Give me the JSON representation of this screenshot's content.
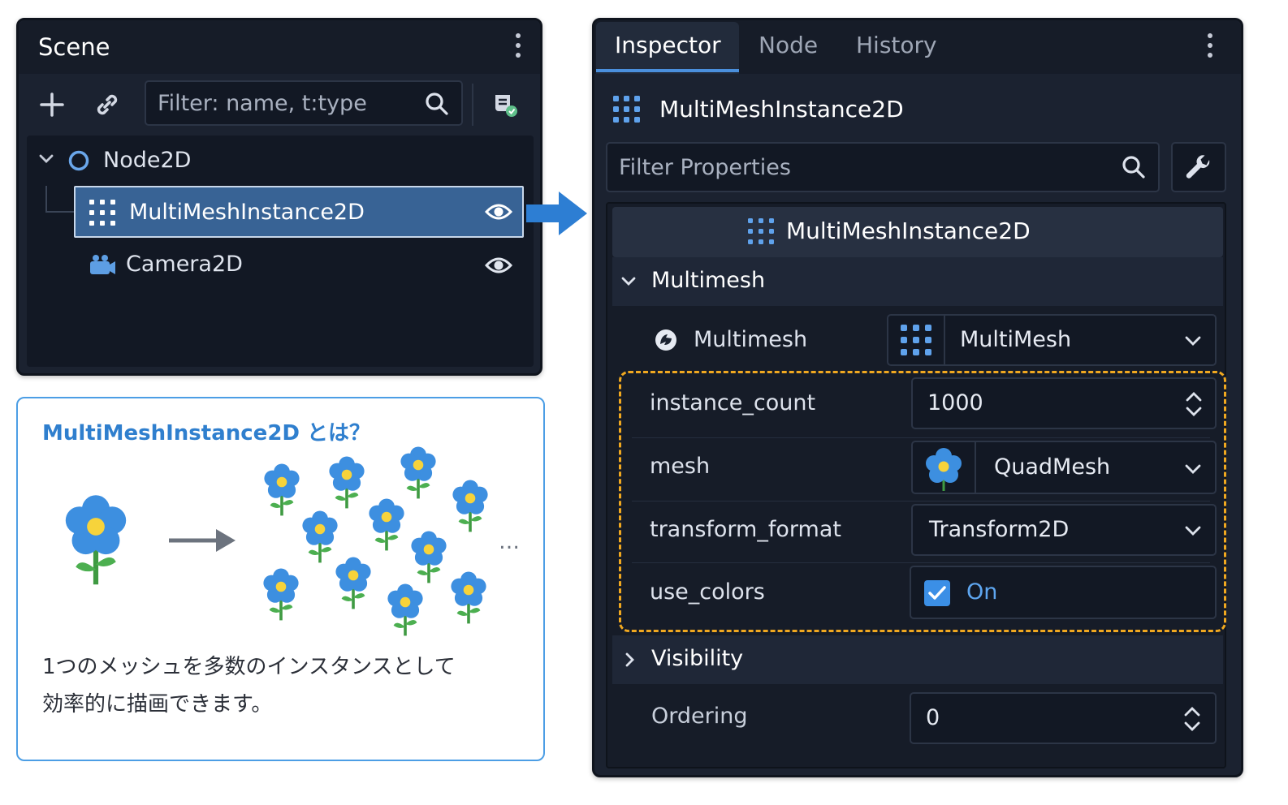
{
  "scene_panel": {
    "title": "Scene",
    "filter_placeholder": "Filter: name, t:type",
    "tree": [
      {
        "label": "Node2D"
      },
      {
        "label": "MultiMeshInstance2D"
      },
      {
        "label": "Camera2D"
      }
    ]
  },
  "info_card": {
    "title": "MultiMeshInstance2D とは？",
    "ellipsis": "…",
    "desc_line1": "1つのメッシュを多数のインスタンスとして",
    "desc_line2": "効率的に描画できます。"
  },
  "inspector": {
    "tabs": [
      {
        "label": "Inspector"
      },
      {
        "label": "Node"
      },
      {
        "label": "History"
      }
    ],
    "node_title": "MultiMeshInstance2D",
    "filter_placeholder": "Filter Properties",
    "class_header": "MultiMeshInstance2D",
    "section_multimesh": "Multimesh",
    "multimesh_label": "Multimesh",
    "multimesh_value": "MultiMesh",
    "props": {
      "instance_count": {
        "label": "instance_count",
        "value": "1000"
      },
      "mesh": {
        "label": "mesh",
        "value": "QuadMesh"
      },
      "transform_format": {
        "label": "transform_format",
        "value": "Transform2D"
      },
      "use_colors": {
        "label": "use_colors",
        "value": "On",
        "checked": true
      }
    },
    "section_visibility": "Visibility",
    "ordering": {
      "label": "Ordering",
      "value": "0"
    }
  },
  "colors": {
    "accent": "#4a8fdc",
    "highlight": "#f0a820",
    "selected_row": "#386395"
  }
}
